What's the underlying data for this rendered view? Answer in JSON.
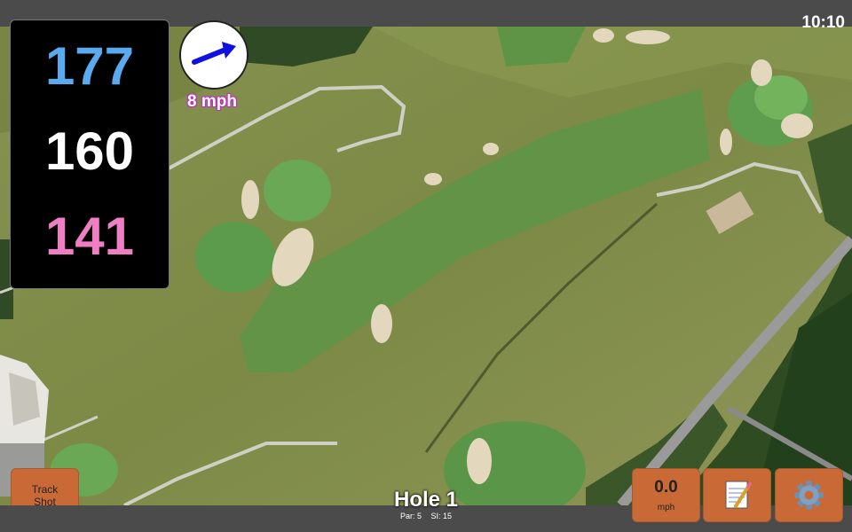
{
  "status": {
    "time": "10:10"
  },
  "distances": {
    "back": "177",
    "middle": "160",
    "front": "141",
    "colors": {
      "back": "#5aaaf0",
      "middle": "#ffffff",
      "front": "#f07ec4"
    }
  },
  "wind": {
    "speed_label": "8 mph",
    "arrow_icon": "right-arrow-icon",
    "arrow_color": "#1010e0"
  },
  "buttons": {
    "track_shot": [
      "Track",
      "Shot"
    ],
    "speed_value": "0.0",
    "speed_unit": "mph",
    "notes_icon": "notepad-icon",
    "settings_icon": "gear-icon",
    "accent": "#c96a36"
  },
  "hole": {
    "title": "Hole 1",
    "par": "Par: 5",
    "si": "SI: 15"
  },
  "map": {
    "type": "satellite-golf-hole"
  }
}
